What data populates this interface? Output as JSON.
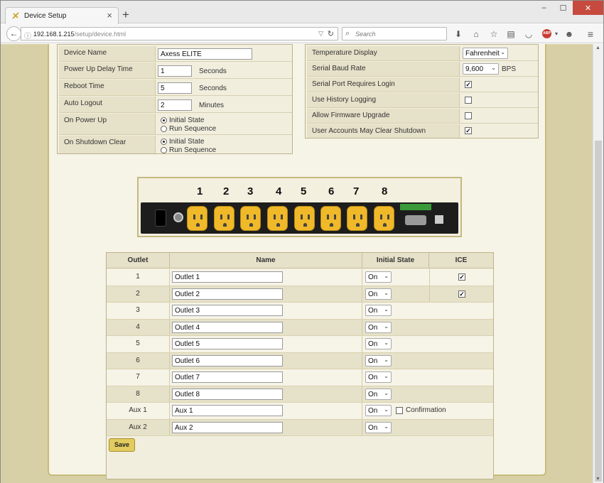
{
  "browser": {
    "tab_title": "Device Setup",
    "new_tab": "+",
    "url_host": "192.168.1.215",
    "url_path": "/setup/device.html",
    "search_placeholder": "Search",
    "abp_label": "ABP"
  },
  "settings_left": {
    "device_name": {
      "label": "Device Name",
      "value": "Axess ELITE"
    },
    "power_up_delay": {
      "label": "Power Up Delay Time",
      "value": "1",
      "unit": "Seconds"
    },
    "reboot_time": {
      "label": "Reboot Time",
      "value": "5",
      "unit": "Seconds"
    },
    "auto_logout": {
      "label": "Auto Logout",
      "value": "2",
      "unit": "Minutes"
    },
    "on_power_up": {
      "label": "On Power Up",
      "option1": "Initial State",
      "option2": "Run Sequence",
      "selected": "Initial State"
    },
    "on_shutdown_clear": {
      "label": "On Shutdown Clear",
      "option1": "Initial State",
      "option2": "Run Sequence",
      "selected": "Initial State"
    }
  },
  "settings_right": {
    "temperature_display": {
      "label": "Temperature Display",
      "value": "Fahrenheit"
    },
    "serial_baud_rate": {
      "label": "Serial Baud Rate",
      "value": "9,600",
      "unit": "BPS"
    },
    "serial_login": {
      "label": "Serial Port Requires Login",
      "checked": true
    },
    "history_logging": {
      "label": "Use History Logging",
      "checked": false
    },
    "firmware_upgrade": {
      "label": "Allow Firmware Upgrade",
      "checked": false
    },
    "user_clear_shutdown": {
      "label": "User Accounts May Clear Shutdown",
      "checked": true
    }
  },
  "device_image": {
    "outlet_numbers": [
      "1",
      "2",
      "3",
      "4",
      "5",
      "6",
      "7",
      "8"
    ]
  },
  "outlet_table": {
    "headers": {
      "outlet": "Outlet",
      "name": "Name",
      "initial_state": "Initial State",
      "ice": "ICE"
    },
    "rows": [
      {
        "outlet": "1",
        "name": "Outlet 1",
        "state": "On",
        "ice": true
      },
      {
        "outlet": "2",
        "name": "Outlet 2",
        "state": "On",
        "ice": true
      },
      {
        "outlet": "3",
        "name": "Outlet 3",
        "state": "On"
      },
      {
        "outlet": "4",
        "name": "Outlet 4",
        "state": "On"
      },
      {
        "outlet": "5",
        "name": "Outlet 5",
        "state": "On"
      },
      {
        "outlet": "6",
        "name": "Outlet 6",
        "state": "On"
      },
      {
        "outlet": "7",
        "name": "Outlet 7",
        "state": "On"
      },
      {
        "outlet": "8",
        "name": "Outlet 8",
        "state": "On"
      },
      {
        "outlet": "Aux 1",
        "name": "Aux 1",
        "state": "On",
        "confirmation_label": "Confirmation",
        "confirmation": false
      },
      {
        "outlet": "Aux 2",
        "name": "Aux 2",
        "state": "On"
      }
    ]
  },
  "save_label": "Save",
  "colors": {
    "page_bg": "#d7d0a6",
    "panel_bg": "#f6f3e7",
    "label_bg": "#e6e1c9",
    "border": "#c8bc7a",
    "outlet_yellow": "#f0b92a",
    "save_button": "#e2cb5f"
  }
}
